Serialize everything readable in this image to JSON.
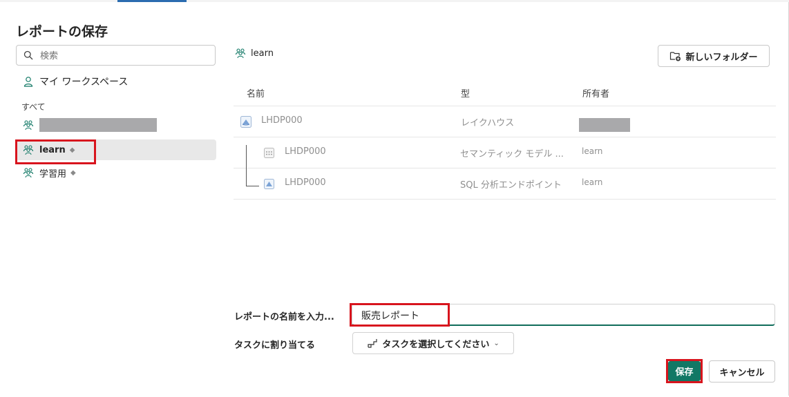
{
  "dialog": {
    "title": "レポートの保存"
  },
  "sidebar": {
    "search_placeholder": "検索",
    "my_workspace": "マイ ワークスペース",
    "section_label": "すべて",
    "workspaces": [
      {
        "label": "",
        "redacted": true
      },
      {
        "label": "learn",
        "premium": true,
        "selected": true
      },
      {
        "label": "学習用",
        "premium": true
      }
    ]
  },
  "main": {
    "breadcrumb": "learn",
    "new_folder_label": "新しいフォルダー",
    "columns": {
      "name": "名前",
      "type": "型",
      "owner": "所有者"
    },
    "items": [
      {
        "name": "LHDP000",
        "type": "レイクハウス",
        "owner": "",
        "icon": "lakehouse-icon"
      },
      {
        "name": "LHDP000",
        "type": "セマンティック モデル ...",
        "owner": "learn",
        "icon": "semantic-model-icon"
      },
      {
        "name": "LHDP000",
        "type": "SQL 分析エンドポイント",
        "owner": "learn",
        "icon": "sql-endpoint-icon"
      }
    ]
  },
  "form": {
    "name_label": "レポートの名前を入力...",
    "name_value": "販売レポート",
    "task_label": "タスクに割り当てる",
    "task_button": "タスクを選択してください"
  },
  "footer": {
    "save": "保存",
    "cancel": "キャンセル"
  },
  "colors": {
    "accent": "#117865",
    "highlight": "#d8141d"
  }
}
